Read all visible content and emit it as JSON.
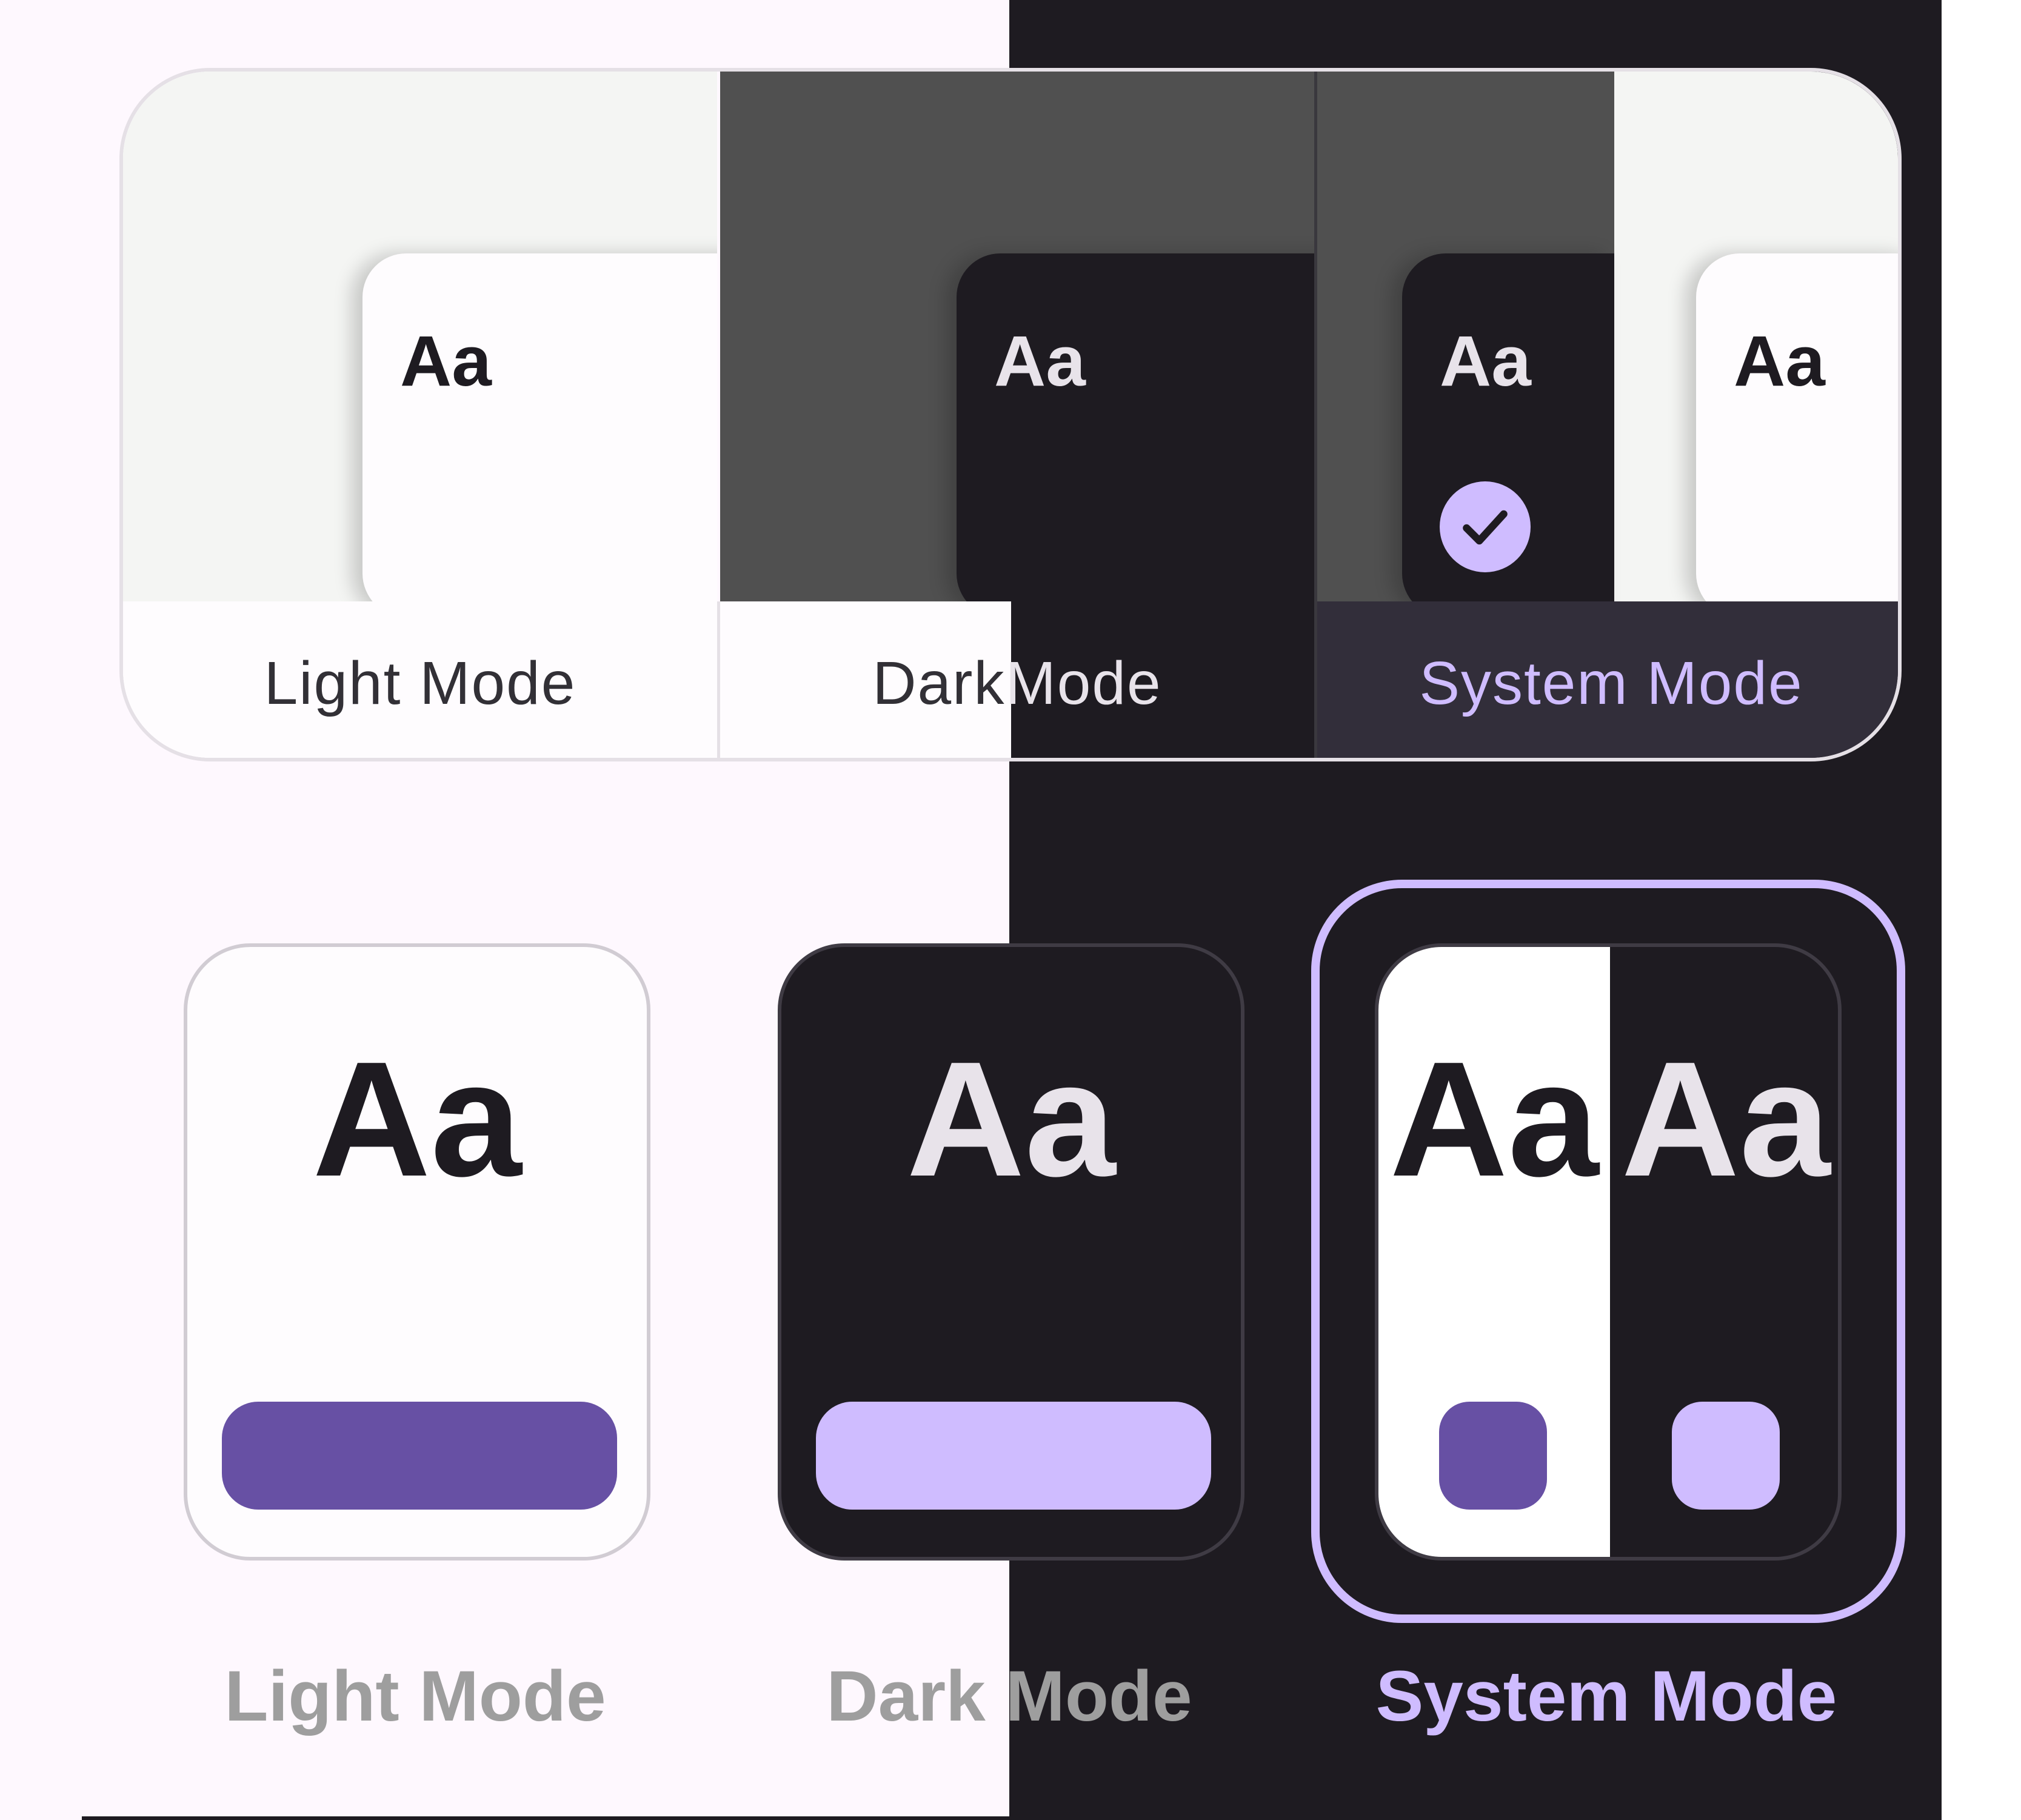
{
  "theme_selector_top": {
    "options": [
      {
        "label": "Light Mode",
        "preview_text": "Aa",
        "selected": false
      },
      {
        "label": "Dark Mode",
        "preview_text": "Aa",
        "selected": false
      },
      {
        "label": "System Mode",
        "preview_text_dark": "Aa",
        "preview_text_light": "Aa",
        "selected": true
      }
    ]
  },
  "theme_selector_cards": {
    "options": [
      {
        "label": "Light Mode",
        "preview_text": "Aa",
        "selected": false
      },
      {
        "label": "Dark Mode",
        "preview_text": "Aa",
        "selected": false
      },
      {
        "label": "System Mode",
        "preview_text_light": "Aa",
        "preview_text_dark": "Aa",
        "selected": true
      }
    ]
  },
  "colors": {
    "light_bg": "#FEF8FE",
    "dark_bg": "#1E1B21",
    "primary_light": "#6750A4",
    "primary_dark": "#CFBCFF",
    "unselected_label": "#9E9E9E"
  },
  "icons": {
    "selected_check": "check-circle-icon"
  }
}
